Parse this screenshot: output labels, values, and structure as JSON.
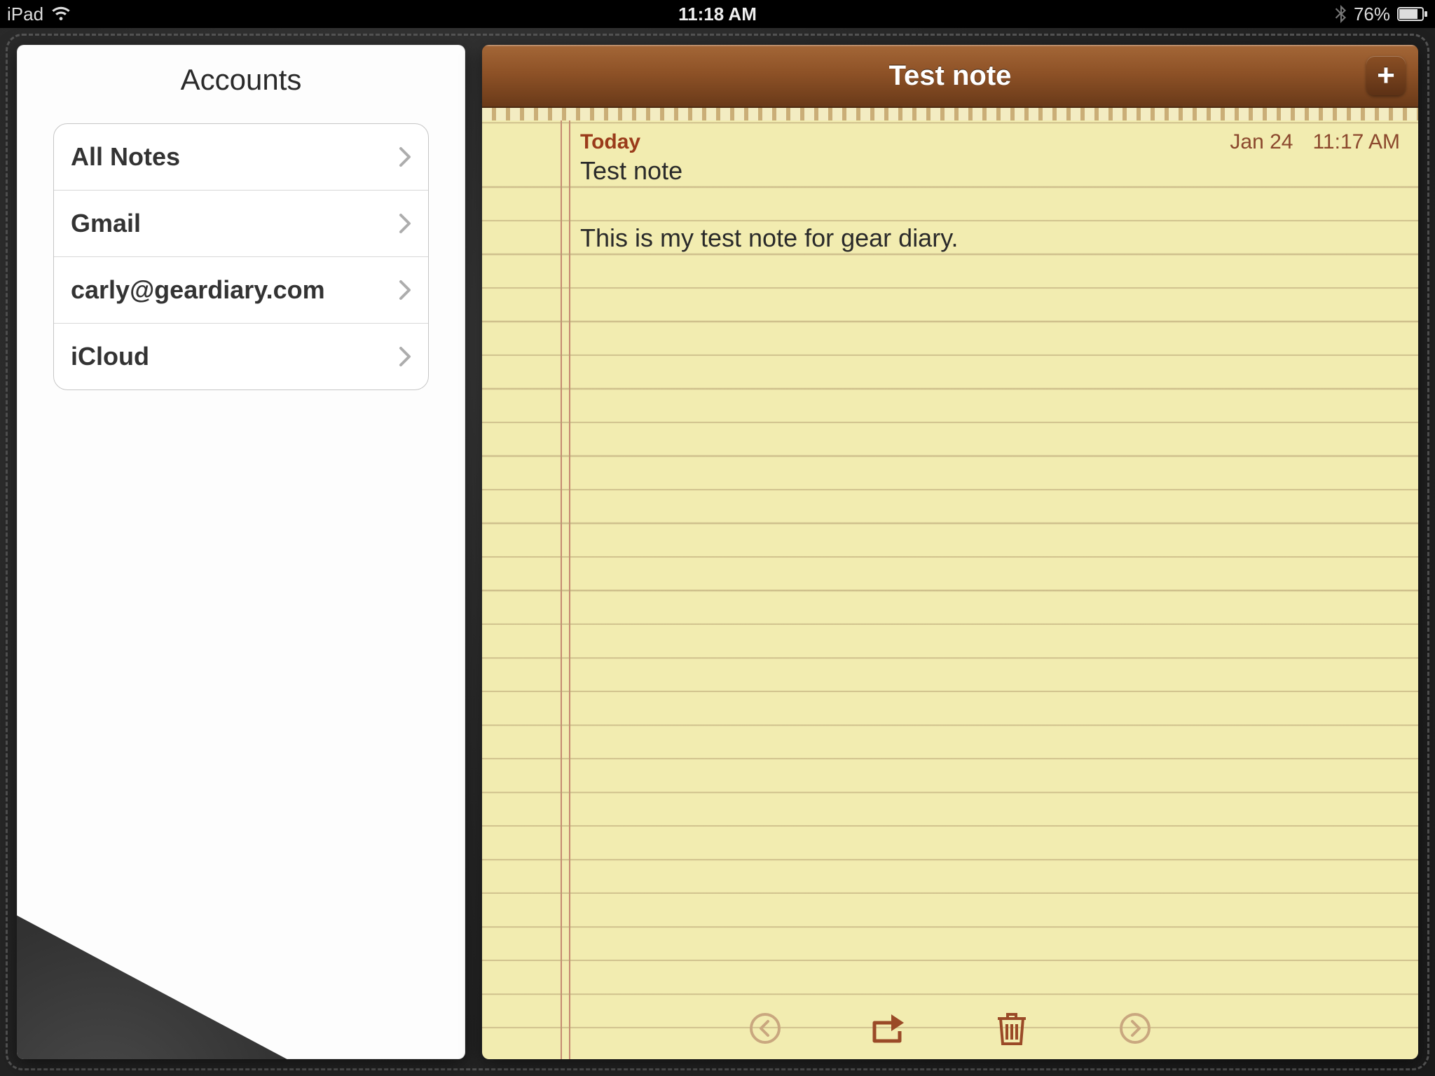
{
  "status_bar": {
    "device": "iPad",
    "time": "11:18 AM",
    "battery_pct": "76%"
  },
  "sidebar": {
    "title": "Accounts",
    "items": [
      {
        "label": "All Notes"
      },
      {
        "label": "Gmail"
      },
      {
        "label": "carly@geardiary.com"
      },
      {
        "label": "iCloud"
      }
    ]
  },
  "note": {
    "header_title": "Test note",
    "today_label": "Today",
    "date": "Jan 24",
    "time": "11:17 AM",
    "title_line": "Test note",
    "body_line": "This is my test note for gear diary."
  }
}
